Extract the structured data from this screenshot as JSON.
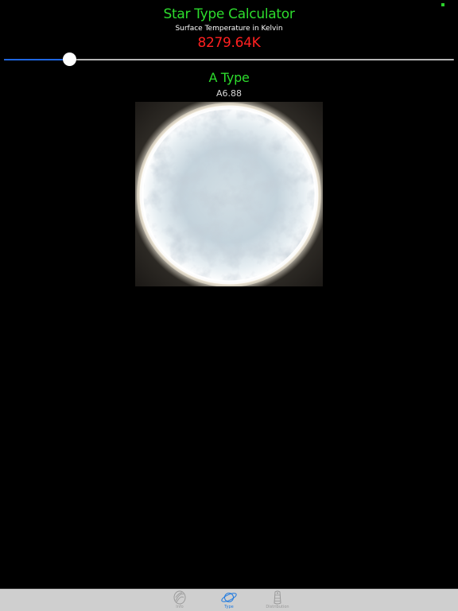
{
  "app": {
    "title": "Star Type Calculator",
    "subtitle": "Surface Temperature in Kelvin",
    "temperature": "8279.64K"
  },
  "slider": {
    "fraction": 0.145,
    "track_color": "#b5b5b5",
    "fill_color": "#1f66e0",
    "thumb_color": "#ffffff"
  },
  "result": {
    "type_label": "A Type",
    "class_label": "A6.88",
    "image_icon": "star-photo"
  },
  "colors": {
    "title": "#2ddc2d",
    "temperature": "#ff2020",
    "tab_active": "#1f7ae0",
    "tab_inactive": "#9a9a9a",
    "status_dot": "#2bd12b"
  },
  "tabbar": {
    "tabs": [
      {
        "label": "Info",
        "icon": "info-shell-icon",
        "active": false
      },
      {
        "label": "Type",
        "icon": "planet-ring-icon",
        "active": true
      },
      {
        "label": "Distribution",
        "icon": "distribution-icon",
        "active": false
      }
    ]
  }
}
